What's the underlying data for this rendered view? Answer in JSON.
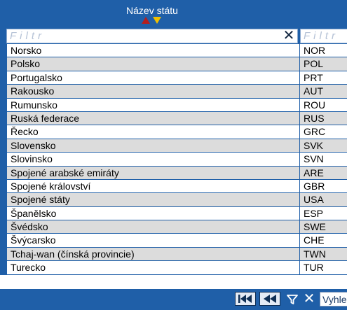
{
  "table": {
    "column_name_header": "Název státu",
    "sort": {
      "asc_color": "#b41e1e",
      "desc_color": "#f0c000",
      "asc_icon": "sort-ascending-icon",
      "desc_icon": "sort-descending-icon"
    },
    "filter_name_placeholder": "Filtr",
    "filter_code_placeholder": "Filtr",
    "clear_filter_icon": "✕",
    "rows": [
      {
        "name": "Norsko",
        "code": "NOR"
      },
      {
        "name": "Polsko",
        "code": "POL"
      },
      {
        "name": "Portugalsko",
        "code": "PRT"
      },
      {
        "name": "Rakousko",
        "code": "AUT"
      },
      {
        "name": "Rumunsko",
        "code": "ROU"
      },
      {
        "name": "Ruská federace",
        "code": "RUS"
      },
      {
        "name": "Řecko",
        "code": "GRC"
      },
      {
        "name": "Slovensko",
        "code": "SVK"
      },
      {
        "name": "Slovinsko",
        "code": "SVN"
      },
      {
        "name": "Spojené arabské emiráty",
        "code": "ARE"
      },
      {
        "name": "Spojené království",
        "code": "GBR"
      },
      {
        "name": "Spojené státy",
        "code": "USA"
      },
      {
        "name": "Španělsko",
        "code": "ESP"
      },
      {
        "name": "Švédsko",
        "code": "SWE"
      },
      {
        "name": "Švýcarsko",
        "code": "CHE"
      },
      {
        "name": "Tchaj-wan (čínská provincie)",
        "code": "TWN"
      },
      {
        "name": "Turecko",
        "code": "TUR"
      }
    ]
  },
  "footer": {
    "first_page_icon": "first-page-icon",
    "prev_page_icon": "previous-page-icon",
    "filter_icon": "filter-icon",
    "close_icon": "✕",
    "search_value": "Vyhle"
  },
  "colors": {
    "header_bg": "#1f5fa8",
    "row_alt": "#dcdcdc",
    "row_base": "#ffffff"
  }
}
